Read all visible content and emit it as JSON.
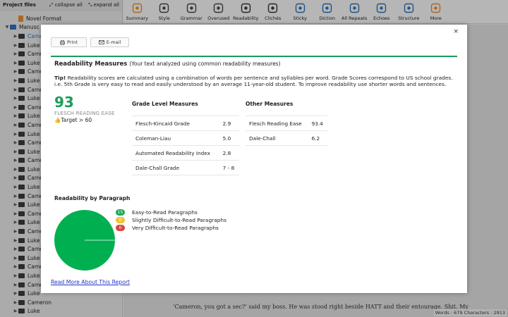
{
  "left_panel": {
    "title": "Project files",
    "collapse_all": "collapse all",
    "expand_all": "expand all",
    "tree": [
      {
        "label": "Novel Format",
        "type": "doc",
        "indent": 1,
        "arrow": ""
      },
      {
        "label": "Manusc",
        "type": "folder-blue",
        "indent": 0,
        "arrow": "▼"
      },
      {
        "label": "Came",
        "type": "folder",
        "indent": 1,
        "arrow": "▶",
        "selected": true
      },
      {
        "label": "Luke",
        "type": "folder",
        "indent": 1,
        "arrow": "▶"
      },
      {
        "label": "Came",
        "type": "folder",
        "indent": 1,
        "arrow": "▶"
      },
      {
        "label": "Luke",
        "type": "folder",
        "indent": 1,
        "arrow": "▶"
      },
      {
        "label": "Came",
        "type": "folder",
        "indent": 1,
        "arrow": "▶"
      },
      {
        "label": "Luke",
        "type": "folder",
        "indent": 1,
        "arrow": "▶"
      },
      {
        "label": "Came",
        "type": "folder",
        "indent": 1,
        "arrow": "▶"
      },
      {
        "label": "Luke",
        "type": "folder",
        "indent": 1,
        "arrow": "▶"
      },
      {
        "label": "Came",
        "type": "folder",
        "indent": 1,
        "arrow": "▶"
      },
      {
        "label": "Luke",
        "type": "folder",
        "indent": 1,
        "arrow": "▶"
      },
      {
        "label": "Came",
        "type": "folder",
        "indent": 1,
        "arrow": "▶"
      },
      {
        "label": "Luke",
        "type": "folder",
        "indent": 1,
        "arrow": "▶"
      },
      {
        "label": "Came",
        "type": "folder",
        "indent": 1,
        "arrow": "▶"
      },
      {
        "label": "Luke",
        "type": "folder",
        "indent": 1,
        "arrow": "▶"
      },
      {
        "label": "Came",
        "type": "folder",
        "indent": 1,
        "arrow": "▶"
      },
      {
        "label": "Luke",
        "type": "folder",
        "indent": 1,
        "arrow": "▶"
      },
      {
        "label": "Came",
        "type": "folder",
        "indent": 1,
        "arrow": "▶"
      },
      {
        "label": "Luke",
        "type": "folder",
        "indent": 1,
        "arrow": "▶"
      },
      {
        "label": "Came",
        "type": "folder",
        "indent": 1,
        "arrow": "▶"
      },
      {
        "label": "Luke",
        "type": "folder",
        "indent": 1,
        "arrow": "▶"
      },
      {
        "label": "Came",
        "type": "folder",
        "indent": 1,
        "arrow": "▶"
      },
      {
        "label": "Luke",
        "type": "folder",
        "indent": 1,
        "arrow": "▶"
      },
      {
        "label": "Came",
        "type": "folder",
        "indent": 1,
        "arrow": "▶"
      },
      {
        "label": "Luke",
        "type": "folder",
        "indent": 1,
        "arrow": "▶"
      },
      {
        "label": "Came",
        "type": "folder",
        "indent": 1,
        "arrow": "▶"
      },
      {
        "label": "Luke",
        "type": "folder",
        "indent": 1,
        "arrow": "▶"
      },
      {
        "label": "Came",
        "type": "folder",
        "indent": 1,
        "arrow": "▶"
      },
      {
        "label": "Luke",
        "type": "folder",
        "indent": 1,
        "arrow": "▶"
      },
      {
        "label": "Came",
        "type": "folder",
        "indent": 1,
        "arrow": "▶"
      },
      {
        "label": "Luke",
        "type": "folder",
        "indent": 1,
        "arrow": "▶"
      },
      {
        "label": "Cameron",
        "type": "folder",
        "indent": 1,
        "arrow": "▶"
      },
      {
        "label": "Luke",
        "type": "folder",
        "indent": 1,
        "arrow": "▶"
      }
    ]
  },
  "toolbar": {
    "items": [
      {
        "label": "Summary",
        "icon": "summary-icon",
        "color": "#e98a2a"
      },
      {
        "label": "Style",
        "icon": "style-icon",
        "color": "#444444"
      },
      {
        "label": "Grammar",
        "icon": "grammar-icon",
        "color": "#444444"
      },
      {
        "label": "Overused",
        "icon": "overused-icon",
        "color": "#444444"
      },
      {
        "label": "Readability",
        "icon": "readability-icon",
        "color": "#333333"
      },
      {
        "label": "Clichés",
        "icon": "cliches-icon",
        "color": "#333333"
      },
      {
        "label": "Sticky",
        "icon": "sticky-icon",
        "color": "#2d6fb6"
      },
      {
        "label": "Diction",
        "icon": "diction-icon",
        "color": "#2d6fb6"
      },
      {
        "label": "All Repeats",
        "icon": "all-repeats-icon",
        "color": "#2d6fb6"
      },
      {
        "label": "Echoes",
        "icon": "echoes-icon",
        "color": "#2d6fb6"
      },
      {
        "label": "Structure",
        "icon": "structure-icon",
        "color": "#2d6fb6"
      },
      {
        "label": "More",
        "icon": "more-icon",
        "color": "#e98a2a"
      }
    ]
  },
  "editor": {
    "visible_text": "‘Cameron, you got a sec?’ said my boss. He was stood right beside HATT and their entourage. Shit. My",
    "status": "Words : 679 Characters : 2913"
  },
  "modal": {
    "close_label": "×",
    "print_label": "Print",
    "email_label": "E-mail",
    "title": "Readability Measures",
    "subtitle": "(Your text analyzed using common readability measures)",
    "tip_label": "Tip!",
    "tip_text": "Readability scores are calculated using a combination of words per sentence and syllables per word. Grade Scores correspond to US school grades. i.e. 5th Grade is very easy to read and easily understood by an average 11-year-old student. To improve readability use shorter words and sentences.",
    "score": "93",
    "score_label": "FLESCH READING EASE",
    "target": "Target > 60",
    "grade_title": "Grade Level Measures",
    "grade_rows": [
      {
        "name": "Flesch-Kincaid Grade",
        "value": "2.9"
      },
      {
        "name": "Coleman-Liau",
        "value": "5.0"
      },
      {
        "name": "Automated Readability Index",
        "value": "2.8"
      },
      {
        "name": "Dale-Chall Grade",
        "value": "7 - 8"
      }
    ],
    "other_title": "Other Measures",
    "other_rows": [
      {
        "name": "Flesch Reading Ease",
        "value": "93.4"
      },
      {
        "name": "Dale-Chall",
        "value": "6.2"
      }
    ],
    "para_title": "Readability by Paragraph",
    "legend": [
      {
        "count": "15",
        "label": "Easy-to-Read Paragraphs",
        "color": "#1aa85a"
      },
      {
        "count": "0",
        "label": "Slightly Difficult-to-Read Paragraphs",
        "color": "#f2c037"
      },
      {
        "count": "0",
        "label": "Very Difficult-to-Read Paragraphs",
        "color": "#d9453a"
      }
    ],
    "read_more": "Read More About This Report"
  },
  "chart_data": {
    "type": "pie",
    "categories": [
      "Easy-to-Read Paragraphs",
      "Slightly Difficult-to-Read Paragraphs",
      "Very Difficult-to-Read Paragraphs"
    ],
    "values": [
      15,
      0,
      0
    ],
    "colors": [
      "#00b050",
      "#f2c037",
      "#d9453a"
    ]
  },
  "colors": {
    "accent_green": "#1a9b5c",
    "link_blue": "#2233cc"
  }
}
